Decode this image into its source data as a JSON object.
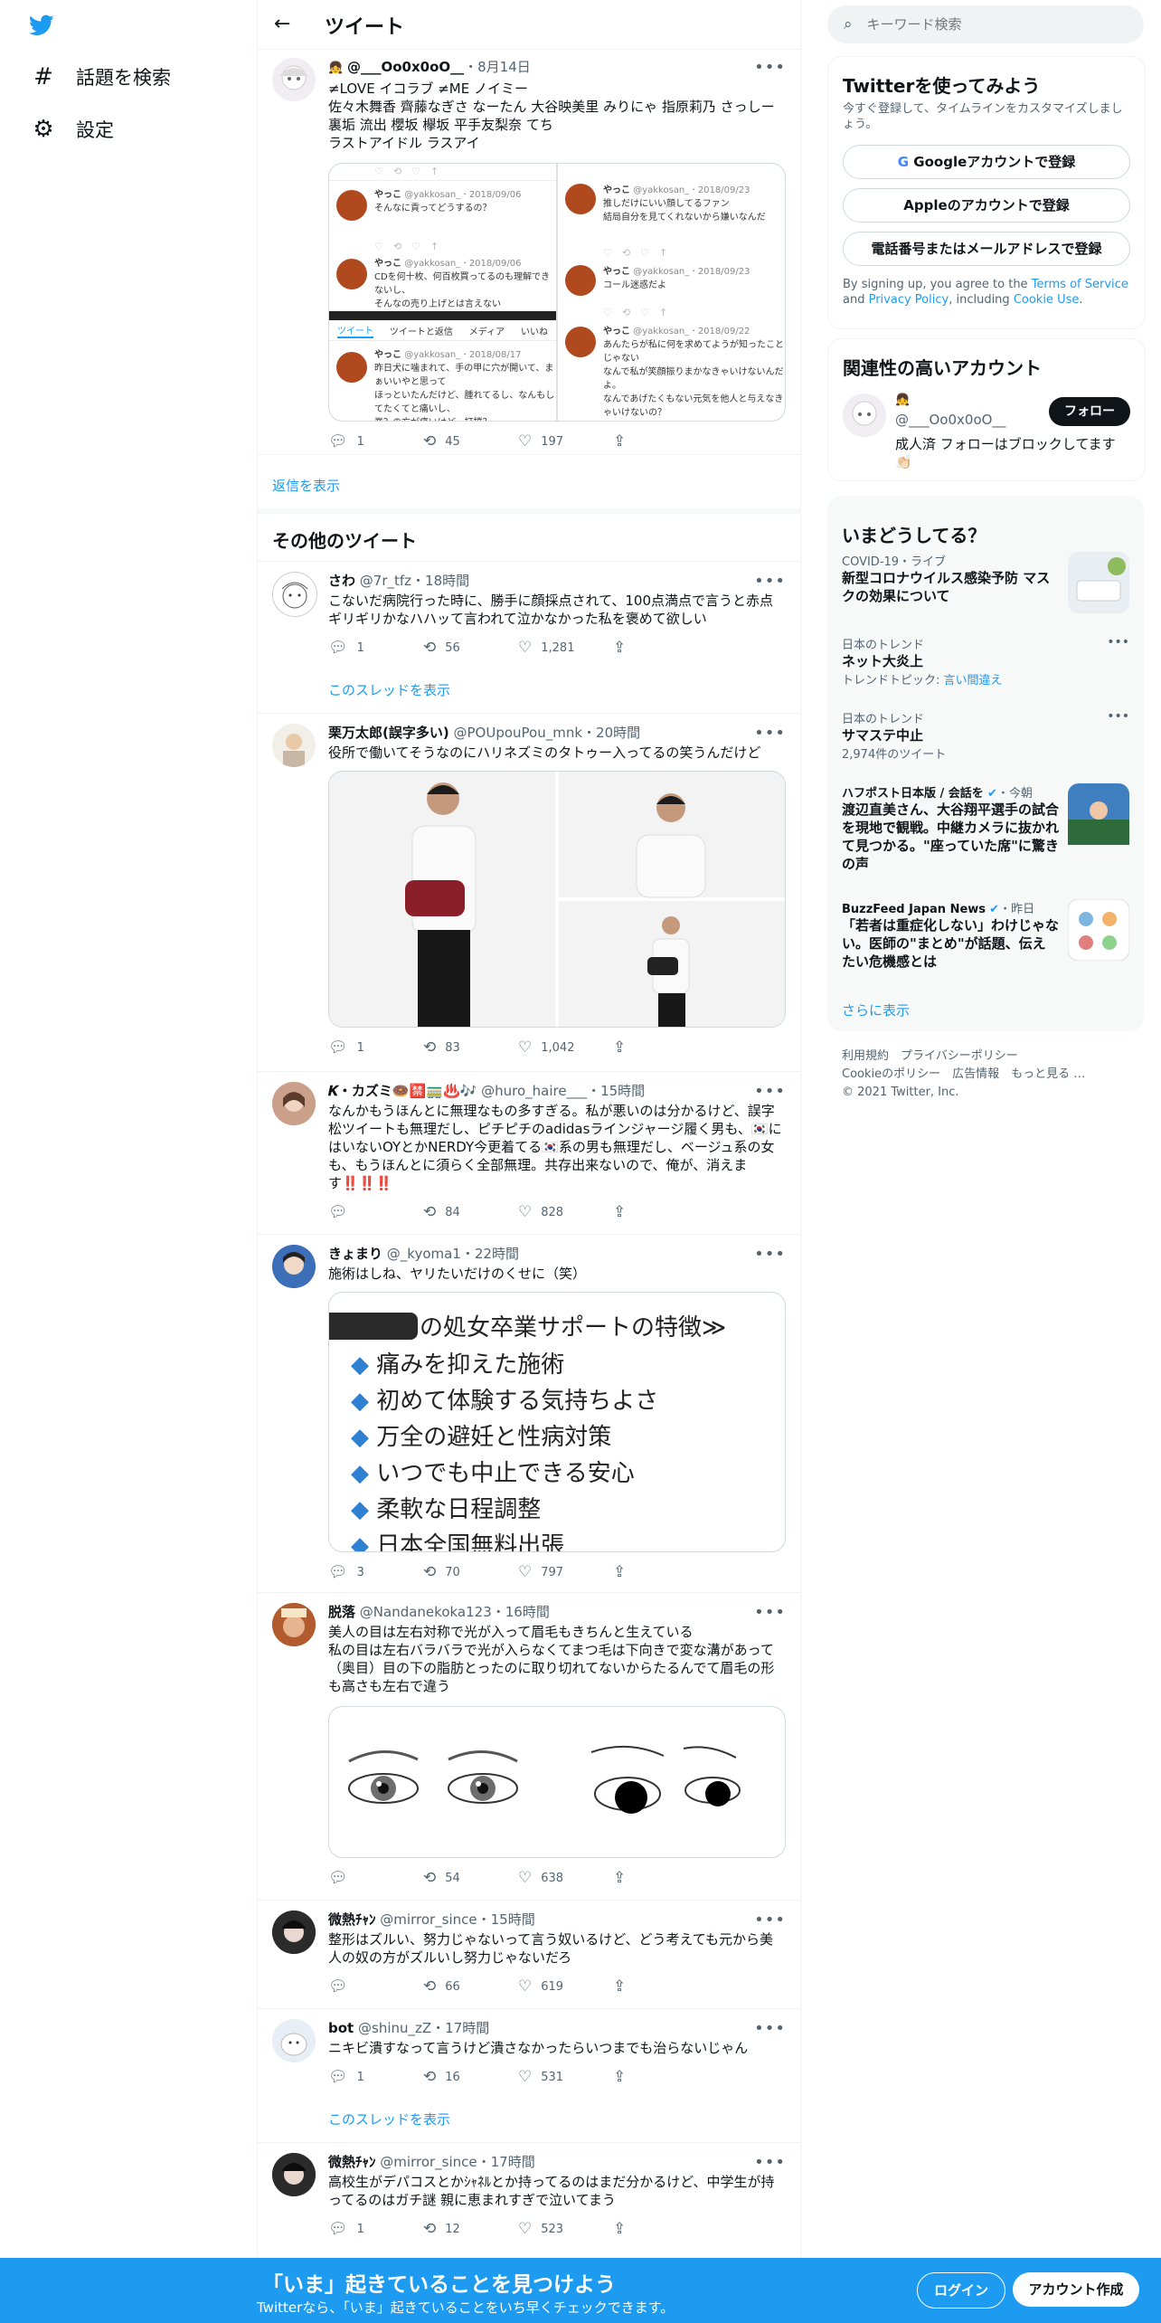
{
  "sidebar": {
    "logo_icon": "twitter-bird-icon",
    "items": [
      {
        "label": "話題を検索",
        "icon": "hash-icon"
      },
      {
        "label": "設定",
        "icon": "gear-icon"
      }
    ]
  },
  "header": {
    "title": "ツイート"
  },
  "main_tweet": {
    "name": "@___Oo0x0oO__",
    "date": "・8月14日",
    "text": "≠LOVE イコラブ ≠ME ノイミー\n佐々木舞香 齊藤なぎさ なーたん 大谷映美里 みりにゃ 指原莉乃 さっしー 裏垢 流出 櫻坂 欅坂 平手友梨奈 てち\nラストアイドル ラスアイ",
    "stats": {
      "replies": "1",
      "retweets": "45",
      "likes": "197"
    },
    "quoted": {
      "author": "やっこ",
      "handle": "@yakkosan_",
      "left_posts": [
        {
          "date": "2018/09/06",
          "text": "そんなに貢ってどうするの？"
        },
        {
          "date": "2018/09/06",
          "text": "CDを何十枚、何百枚買ってるのも理解できないし、\nそんなの売り上げとは言えない"
        },
        {
          "date": "2018/08/17",
          "text": "昨日犬に噛まれて、手の甲に穴が開いて、まぁいいやと思って\nほっといたんだけど、腫れてるし、なんもしてたくてと痛いし、\n脊？の方が痛いけど、打撲？"
        }
      ],
      "right_posts": [
        {
          "date": "2018/09/23",
          "text": "推しだけにいい顔してるファン\n結局自分を見てくれないから嫌いなんだ"
        },
        {
          "date": "2018/09/23",
          "text": "コール迷惑だよ"
        },
        {
          "date": "2018/09/22",
          "text": "あんたらが私に何を求めてようが知ったことじゃない\nなんで私が笑顔振りまかなきゃいけないんだよ。\nなんであげたくもない元気を他人と与えなきゃいけないの？"
        }
      ],
      "tabs": [
        "ツイート",
        "ツイートと返信",
        "メディア",
        "いいね"
      ]
    }
  },
  "show_replies": "返信を表示",
  "more_tweets_title": "その他のツイート",
  "tweets": [
    {
      "name": "さわ",
      "handle": "@7r_tfz",
      "time": "・18時間",
      "text": "こないだ病院行った時に、勝手に顔採点されて、100点満点で言うと赤点ギリギリかなハハッて言われて泣かなかった私を褒めて欲しい",
      "stats": {
        "replies": "1",
        "retweets": "56",
        "likes": "1,281"
      },
      "thread": "このスレッドを表示"
    },
    {
      "name": "栗万太郎(誤字多い)",
      "handle": "@POUpouPou_mnk",
      "time": "・20時間",
      "text": "役所で働いてそうなのにハリネズミのタトゥー入ってるの笑うんだけど",
      "stats": {
        "replies": "1",
        "retweets": "83",
        "likes": "1,042"
      }
    },
    {
      "name": "𝑲・カズミ🍩🈲🚃♨️🎶",
      "handle": "@huro_haire___",
      "time": "・15時間",
      "text": "なんかもうほんとに無理なもの多すぎる。私が悪いのは分かるけど、誤字松ツイートも無理だし、ピチピチのadidasラインジャージ履く男も、🇰🇷にはいないOYとかNERDY今更着てる🇰🇷系の男も無理だし、ベージュ系の女も、もうほんとに須らく全部無理。共存出来ないので、俺が、消えます‼️‼️‼️",
      "stats": {
        "replies": "",
        "retweets": "84",
        "likes": "828"
      }
    },
    {
      "name": "きょまり",
      "handle": "@_kyoma1",
      "time": "・22時間",
      "text": "施術はしね、ヤリたいだけのくせに（笑）",
      "stats": {
        "replies": "3",
        "retweets": "70",
        "likes": "797"
      },
      "image_title": "の処女卒業サポートの特徴≫",
      "image_lines": [
        "痛みを抑えた施術",
        "初めて体験する気持ちよさ",
        "万全の避妊と性病対策",
        "いつでも中止できる安心",
        "柔軟な日程調整",
        "日本全国無料出張"
      ]
    },
    {
      "name": "脱落",
      "handle": "@Nandanekoka123",
      "time": "・16時間",
      "text": "美人の目は左右対称で光が入って眉毛もきちんと生えている\n私の目は左右バラバラで光が入らなくてまつ毛は下向きで変な溝があって（奥目）目の下の脂肪とったのに取り切れてないからたるんでて眉毛の形も高さも左右で違う",
      "stats": {
        "replies": "",
        "retweets": "54",
        "likes": "638"
      }
    },
    {
      "name": "微熱ﾁｬﾝ",
      "handle": "@mirror_since",
      "time": "・15時間",
      "text": "整形はズルい、努力じゃないって言う奴いるけど、どう考えても元から美人の奴の方がズルいし努力じゃないだろ",
      "stats": {
        "replies": "",
        "retweets": "66",
        "likes": "619"
      }
    },
    {
      "name": "bot",
      "handle": "@shinu_zZ",
      "time": "・17時間",
      "text": "ニキビ潰すなって言うけど潰さなかったらいつまでも治らないじゃん",
      "stats": {
        "replies": "1",
        "retweets": "16",
        "likes": "531"
      },
      "thread": "このスレッドを表示"
    },
    {
      "name": "微熱ﾁｬﾝ",
      "handle": "@mirror_since",
      "time": "・17時間",
      "text": "高校生がデパコスとかｼｬﾈﾙとか持ってるのはまだ分かるけど、中学生が持ってるのはガチ謎 親に恵まれすぎで泣いてまう",
      "stats": {
        "replies": "1",
        "retweets": "12",
        "likes": "523"
      }
    }
  ],
  "right": {
    "search_placeholder": "キーワード検索",
    "signup_box": {
      "title": "Twitterを使ってみよう",
      "subtitle": "今すぐ登録して、タイムラインをカスタマイズしましょう。",
      "google": "Googleアカウントで登録",
      "apple": "Appleのアカウントで登録",
      "phone": "電話番号またはメールアドレスで登録",
      "terms_prefix": "By signing up, you agree to the ",
      "terms_link": "Terms of Service",
      "terms_and": " and ",
      "privacy_link": "Privacy Policy",
      "terms_incl": ", including ",
      "cookie_link": "Cookie Use",
      "terms_end": "."
    },
    "related": {
      "title": "関連性の高いアカウント",
      "handle": "@___Oo0x0oO__",
      "follow": "フォロー",
      "bio": "成人済 フォローはブロックしてます👏🏻"
    },
    "trends": {
      "title": "いまどうしてる？",
      "items": [
        {
          "category": "COVID-19・ライブ",
          "title": "新型コロナウイルス感染予防 マスクの効果について"
        },
        {
          "category": "日本のトレンド",
          "title": "ネット大炎上",
          "sub_prefix": "トレンドトピック: ",
          "sub_link": "言い間違え"
        },
        {
          "category": "日本のトレンド",
          "title": "サマステ中止",
          "sub": "2,974件のツイート"
        },
        {
          "category": "ハフポスト日本版 / 会話を",
          "time": "・今朝",
          "title": "渡辺直美さん、大谷翔平選手の試合を現地で観戦。中継カメラに抜かれて見つかる。\"座っていた席\"に驚きの声"
        },
        {
          "category": "BuzzFeed Japan News",
          "time": "・昨日",
          "title": "「若者は重症化しない」わけじゃない。医師の\"まとめ\"が話題、伝えたい危機感とは"
        }
      ],
      "show_more": "さらに表示"
    },
    "footer": {
      "line1": "利用規約　プライバシーポリシー",
      "line2": "Cookieのポリシー　広告情報　もっと見る …",
      "line3": "© 2021 Twitter, Inc."
    }
  },
  "banner": {
    "title": "「いま」起きていることを見つけよう",
    "subtitle": "Twitterなら、「いま」起きていることをいち早くチェックできます。",
    "login": "ログイン",
    "signup": "アカウント作成"
  }
}
